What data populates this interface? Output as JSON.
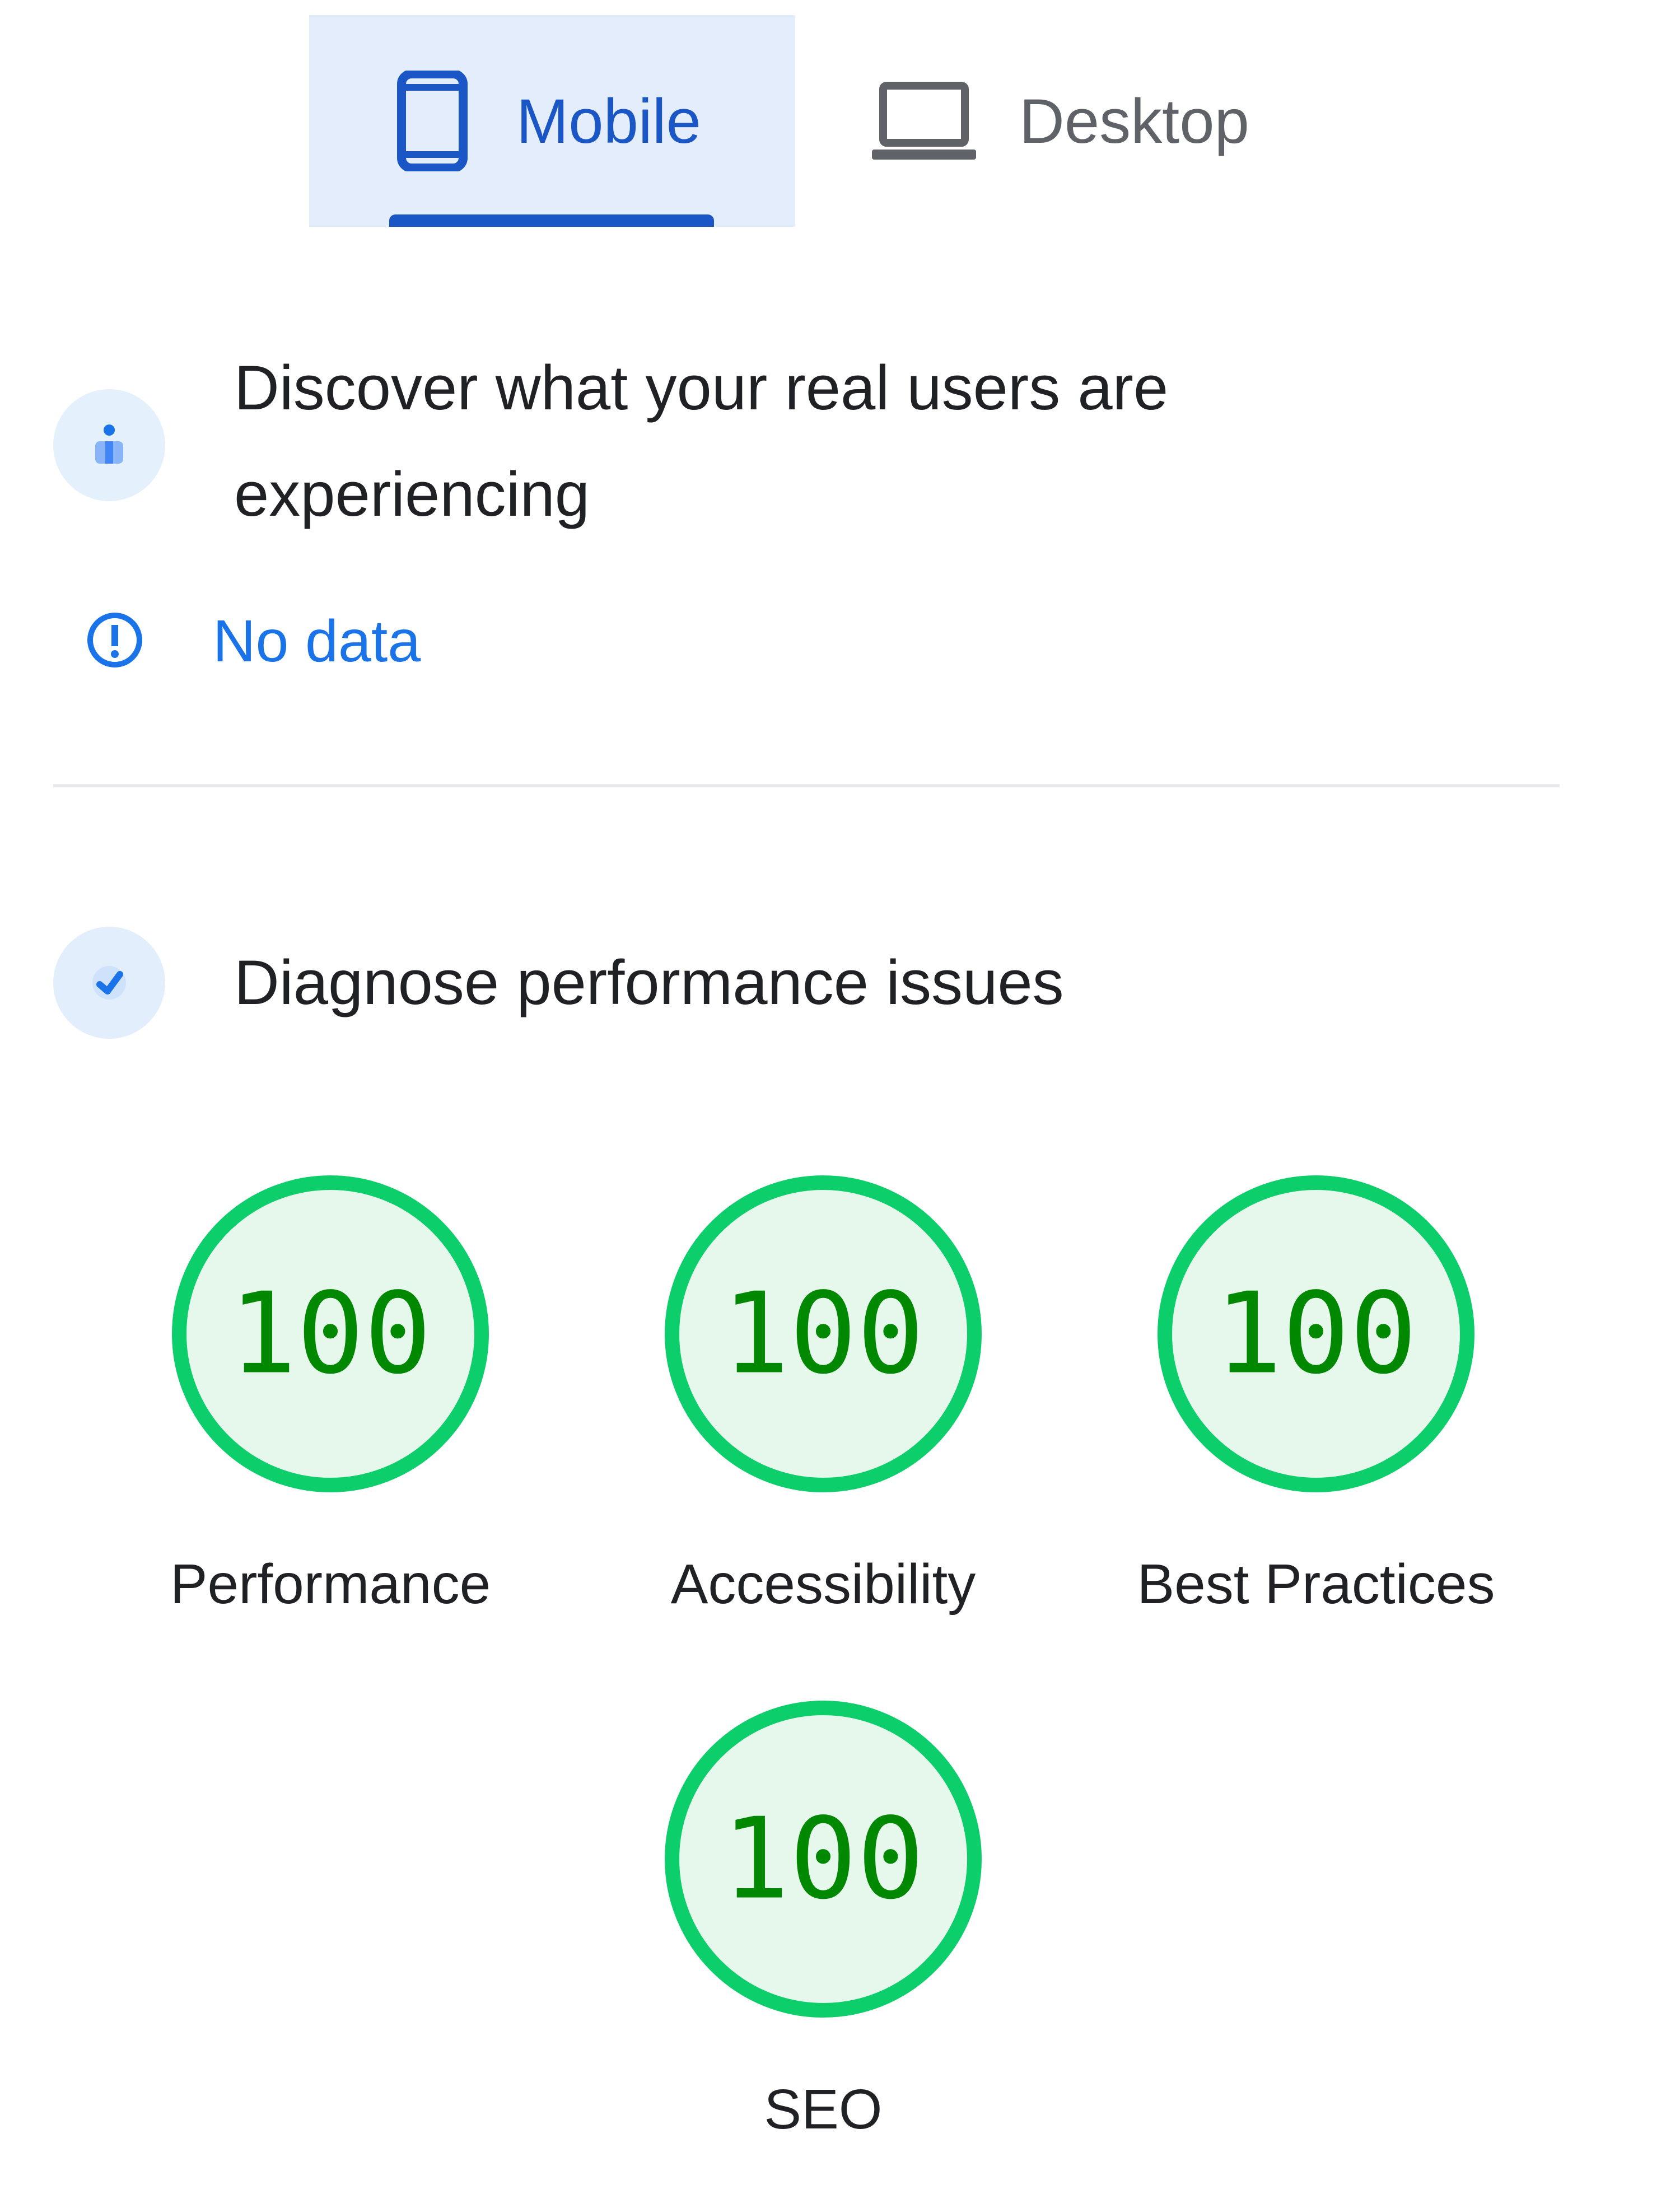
{
  "tabs": [
    {
      "label": "Mobile",
      "icon": "smartphone-icon",
      "selected": true
    },
    {
      "label": "Desktop",
      "icon": "laptop-icon",
      "selected": false
    }
  ],
  "field_data": {
    "icon": "people-icon",
    "title": "Discover what your real users are experiencing",
    "status": {
      "icon": "info-icon",
      "label": "No data"
    }
  },
  "diagnose": {
    "icon": "lighthouse-icon",
    "title": "Diagnose performance issues"
  },
  "scores": [
    {
      "value": "100",
      "label": "Performance"
    },
    {
      "value": "100",
      "label": "Accessibility"
    },
    {
      "value": "100",
      "label": "Best Practices"
    },
    {
      "value": "100",
      "label": "SEO"
    }
  ],
  "colors": {
    "accent": "#1a56c6",
    "link": "#1a73e8",
    "pass": "#0cce6b",
    "pass_fill": "#e6f7ec",
    "pass_text": "#008800",
    "tab_selected_bg": "#e3edfb"
  }
}
